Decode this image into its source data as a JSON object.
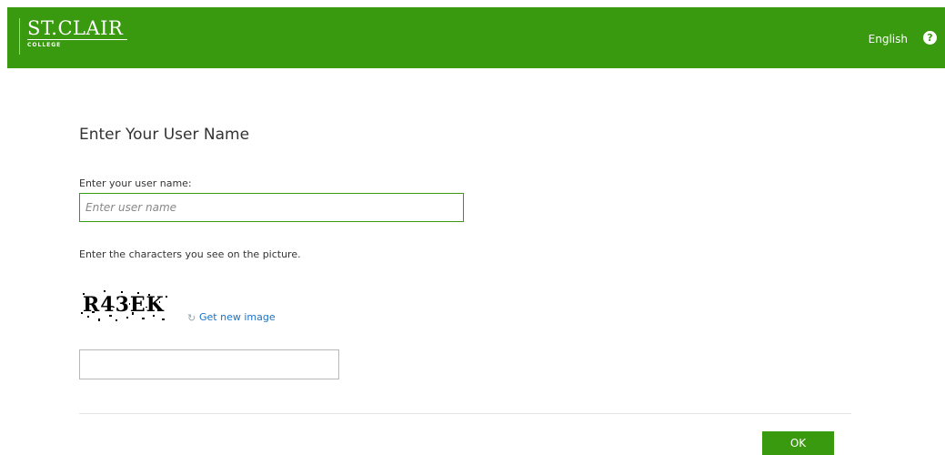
{
  "header": {
    "logo_main": "ST.CLAIR",
    "logo_sub": "COLLEGE",
    "language": "English",
    "help_icon": "question-circle-icon",
    "bg_color": "#3a9a0f"
  },
  "form": {
    "title": "Enter Your User Name",
    "username_label": "Enter your user name:",
    "username_placeholder": "Enter user name",
    "username_value": "",
    "captcha_instruction": "Enter the characters you see on the picture.",
    "captcha_text": "R43EK",
    "refresh_icon": "refresh-icon",
    "refresh_label": "Get new image",
    "captcha_value": "",
    "ok_label": "OK"
  }
}
